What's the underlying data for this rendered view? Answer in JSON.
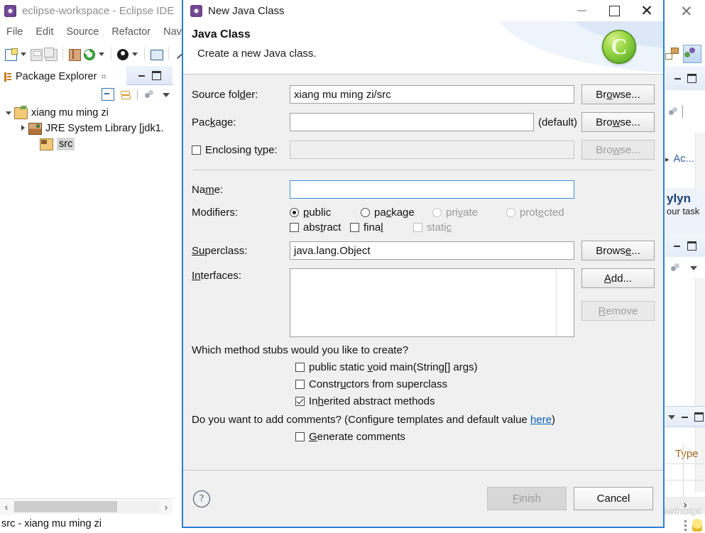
{
  "ide": {
    "title": "eclipse-workspace - Eclipse IDE",
    "title_icon": "eclipse-icon",
    "menu": [
      "File",
      "Edit",
      "Source",
      "Refactor",
      "Navi"
    ],
    "toolbar_icons": [
      "new-file-icon",
      "dropdown-arrow-icon",
      "save-icon",
      "save-all-icon",
      "new-java-package-icon",
      "debug-icon",
      "dropdown-arrow-icon",
      "run-icon",
      "dropdown-arrow-icon",
      "open-console-icon",
      "skip-breakpoints-icon"
    ],
    "explorer": {
      "tab_label": "Package Explorer",
      "tab_close": "⌗",
      "minimize_label": "Minimize",
      "maximize_label": "Maximize",
      "view_tools": [
        "collapse-all-icon",
        "link-with-editor-icon",
        "view-menu-balls-icon",
        "view-menu-icon"
      ],
      "tree": [
        {
          "label": "xiang mu ming zi",
          "icon": "project-folder-icon",
          "twisty": "down",
          "indent": 0,
          "selected": false
        },
        {
          "label": "JRE System Library [jdk1.",
          "icon": "jre-library-icon",
          "twisty": "right",
          "indent": 1,
          "selected": false
        },
        {
          "label": "src",
          "icon": "source-folder-icon",
          "twisty": "none",
          "indent": 1,
          "selected": true
        }
      ],
      "hscroll_left": "‹",
      "hscroll_right": "›"
    },
    "status_text": "src - xiang mu ming zi",
    "right_panels": {
      "close_glyph": "✕",
      "outline_arrow": "▸",
      "outline_label": "Ac...",
      "mylyn_title": "ylyn",
      "mylyn_sub": "our task",
      "table_header": "Type",
      "scroll_arrow": "›"
    },
    "watermark": "https://blog.csdn.net/Lfiwthotpt"
  },
  "dialog": {
    "title": "New Java Class",
    "title_icon": "eclipse-icon",
    "window_buttons": {
      "minimize": "minimize-button",
      "maximize": "maximize-button",
      "close": "✕"
    },
    "header": {
      "title": "Java Class",
      "subtitle": "Create a new Java class.",
      "logo_glyph": "C"
    },
    "fields": {
      "source_folder": {
        "label_pre": "Source fol",
        "label_mnemonic": "d",
        "label_post": "er:",
        "value": "xiang mu ming zi/src",
        "browse_pre": "Br",
        "browse_mn": "o",
        "browse_post": "wse..."
      },
      "package": {
        "label_pre": "Pac",
        "label_mnemonic": "k",
        "label_post": "age:",
        "value": "",
        "suffix": "(default)",
        "browse_pre": "Bro",
        "browse_mn": "w",
        "browse_post": "se..."
      },
      "enclosing_type": {
        "label_pre": "Enclosing t",
        "label_mnemonic": "y",
        "label_post": "pe:",
        "checked": false,
        "value": "",
        "browse_pre": "Bro",
        "browse_mn": "w",
        "browse_post": "se...",
        "disabled": true
      },
      "name": {
        "label_pre": "Na",
        "label_mnemonic": "m",
        "label_post": "e:",
        "value": "",
        "focused": true
      },
      "modifiers": {
        "label": "Modifiers:",
        "radios": [
          {
            "pre": "",
            "mn": "p",
            "post": "ublic",
            "checked": true,
            "enabled": true
          },
          {
            "pre": "pa",
            "mn": "c",
            "post": "kage",
            "checked": false,
            "enabled": true
          },
          {
            "pre": "pri",
            "mn": "v",
            "post": "ate",
            "checked": false,
            "enabled": false
          },
          {
            "pre": "prot",
            "mn": "e",
            "post": "cted",
            "checked": false,
            "enabled": false
          }
        ],
        "checkboxes": [
          {
            "pre": "abs",
            "mn": "t",
            "post": "ract",
            "checked": false,
            "enabled": true
          },
          {
            "pre": "fina",
            "mn": "l",
            "post": "",
            "checked": false,
            "enabled": true
          },
          {
            "pre": "stati",
            "mn": "c",
            "post": "",
            "checked": false,
            "enabled": false
          }
        ]
      },
      "superclass": {
        "label_pre": "S",
        "label_mnemonic": "u",
        "label_post": "perclass:",
        "value": "java.lang.Object",
        "browse_pre": "Brows",
        "browse_mn": "e",
        "browse_post": "..."
      },
      "interfaces": {
        "label_pre": "I",
        "label_mnemonic": "n",
        "label_post": "terfaces:",
        "value": "",
        "add_pre": "",
        "add_mn": "A",
        "add_post": "dd...",
        "remove_pre": "",
        "remove_mn": "R",
        "remove_post": "emove",
        "remove_disabled": true
      }
    },
    "stubs": {
      "question": "Which method stubs would you like to create?",
      "items": [
        {
          "pre": "public static ",
          "mn": "v",
          "post": "oid main(String[] args)",
          "checked": false
        },
        {
          "pre": "Constr",
          "mn": "u",
          "post": "ctors from superclass",
          "checked": false
        },
        {
          "pre": "In",
          "mn": "h",
          "post": "erited abstract methods",
          "checked": true
        }
      ]
    },
    "comments": {
      "question_pre": "Do you want to add comments? (Configure templates and default value ",
      "link": "here",
      "question_post": ")",
      "checkbox": {
        "pre": "",
        "mn": "G",
        "post": "enerate comments",
        "checked": false
      }
    },
    "footer": {
      "help_glyph": "?",
      "finish_pre": "",
      "finish_mn": "F",
      "finish_post": "inish",
      "finish_disabled": true,
      "cancel_label": "Cancel"
    }
  },
  "colors": {
    "dialog_border": "#2a7fd4",
    "dialog_bg": "#f0f0f0",
    "link": "#0a5fb5",
    "accent_green": "#6cba2e",
    "selection": "#d7d7d7"
  }
}
